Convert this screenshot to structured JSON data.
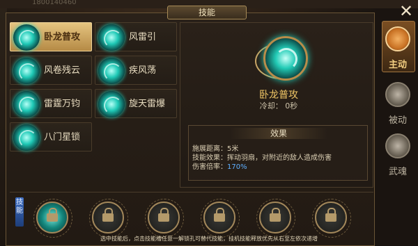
{
  "window": {
    "title": "技能",
    "close_label": "✕",
    "top_id": "1800140460"
  },
  "skills": [
    {
      "label": "卧龙普攻",
      "selected": true
    },
    {
      "label": "风雷引",
      "selected": false
    },
    {
      "label": "风卷残云",
      "selected": false
    },
    {
      "label": "疾风荡",
      "selected": false
    },
    {
      "label": "雷霆万钧",
      "selected": false
    },
    {
      "label": "旋天雷爆",
      "selected": false
    },
    {
      "label": "八门星锁",
      "selected": false
    }
  ],
  "detail": {
    "name": "卧龙普攻",
    "cooldown": "冷却： 0秒",
    "effect_header": "效果",
    "lines": {
      "range": "施展距离：5米",
      "effect": "技能效果：挥动羽扇，对附近的敌人造成伤害",
      "multiplier_label": "伤害倍率：",
      "multiplier_value": "170%"
    }
  },
  "tabs": [
    {
      "label": "主动",
      "icon": "scroll-book-icon",
      "active": true
    },
    {
      "label": "被动",
      "icon": "meditating-figure-icon",
      "active": false
    },
    {
      "label": "武魂",
      "icon": "demon-mask-icon",
      "active": false
    }
  ],
  "slots": {
    "header_label": "技能",
    "count": 6,
    "hint": "选中技能后，点击技能槽任意一解锁孔可替代技能，挂机技能释放优先从右至左依次递增"
  },
  "colors": {
    "accent_gold": "#f1c766",
    "highlight_blue": "#5fb0ff",
    "skill_cyan": "#1fc9b6"
  }
}
